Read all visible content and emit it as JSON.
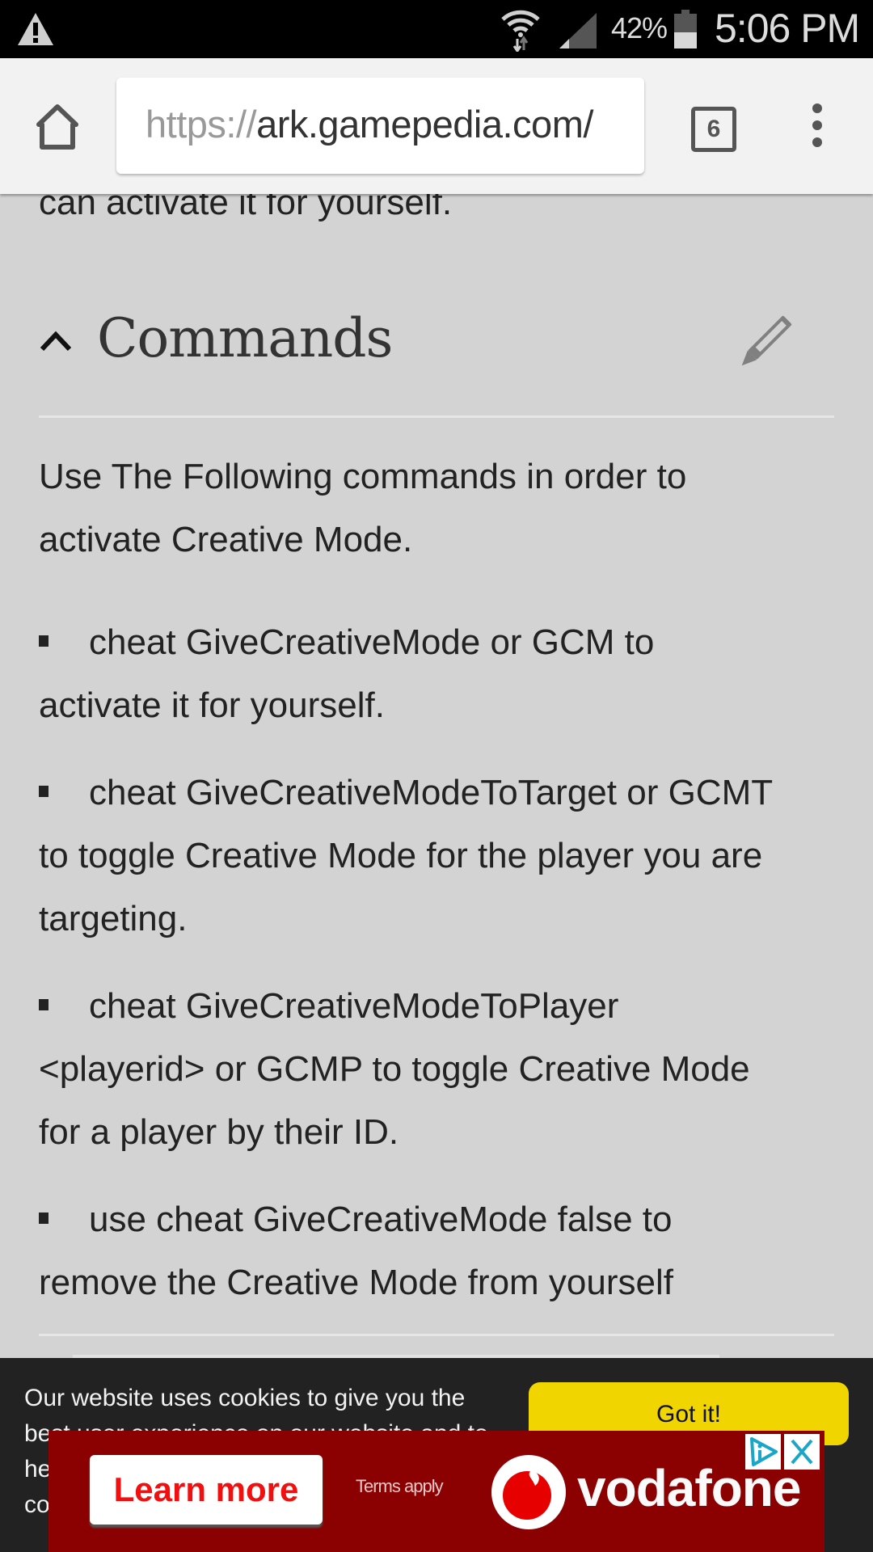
{
  "status_bar": {
    "battery_percent": "42%",
    "battery_level": 0.42,
    "time": "5:06 PM",
    "icons": [
      "warning-icon",
      "wifi-icon",
      "signal-icon",
      "battery-icon"
    ]
  },
  "browser": {
    "url_scheme": "https://",
    "url_host": "ark.gamepedia.com/",
    "tab_count": "6",
    "icons": [
      "home-icon",
      "tabs-icon",
      "overflow-menu-icon"
    ]
  },
  "page": {
    "partial_line": "can activate it for yourself.",
    "section": {
      "title": "Commands",
      "collapse_icon": "chevron-up-icon",
      "edit_icon": "pencil-icon",
      "intro_lines": [
        "Use The Following commands in order to",
        "activate Creative Mode."
      ],
      "bullets": [
        {
          "lines": [
            "cheat GiveCreativeMode or GCM to",
            "activate it for yourself."
          ]
        },
        {
          "lines": [
            "cheat GiveCreativeModeToTarget or GCMT",
            "to toggle Creative Mode for the player you are",
            "targeting."
          ]
        },
        {
          "lines": [
            "cheat GiveCreativeModeToPlayer",
            "<playerid> or GCMP to toggle Creative Mode",
            "for a player by their ID."
          ]
        },
        {
          "lines": [
            "use cheat GiveCreativeMode false to",
            "remove the Creative Mode from yourself"
          ]
        }
      ]
    }
  },
  "cookie_banner": {
    "lines": [
      "Our website uses cookies to give you the",
      "best user experience on our website and to",
      "he",
      "co"
    ],
    "got_it_label": "Got it!",
    "button_color": "#f0d500"
  },
  "ad": {
    "cta_label": "Learn more",
    "terms": "Terms apply",
    "brand": "vodafone",
    "background_color": "#8b0000",
    "icons": [
      "adchoices-icon",
      "close-icon"
    ]
  }
}
